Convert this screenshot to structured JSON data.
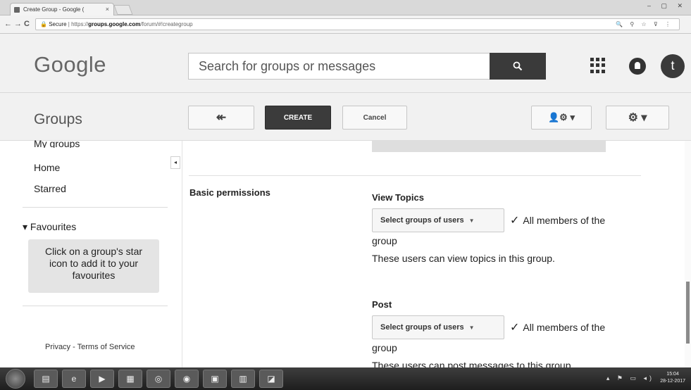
{
  "browser": {
    "tab_title": "Create Group - Google (",
    "tab_close": "×",
    "window_controls": "– ▢ ✕",
    "nav_back": "←",
    "nav_forward": "→",
    "nav_reload": "C",
    "url_secure": "Secure",
    "url_prefix": "https://",
    "url_host": "groups.google.com",
    "url_path": "/forum/#!creategroup",
    "omnibox_icons": "🔍 ⚲ ☆ ⊽ ⋮"
  },
  "header": {
    "logo": "Google",
    "search_placeholder": "Search for groups or messages",
    "avatar_letter": "t"
  },
  "toolbar": {
    "section_title": "Groups",
    "back_label": "↞",
    "create_label": "CREATE",
    "cancel_label": "Cancel",
    "members_label": "👤⚙ ▾",
    "settings_label": "⚙ ▾"
  },
  "sidebar": {
    "items": [
      {
        "label": "My groups"
      },
      {
        "label": "Home"
      },
      {
        "label": "Starred"
      }
    ],
    "favourites_heading": "▾ Favourites",
    "favourites_hint_line1": "Click on a group's star",
    "favourites_hint_line2": "icon to add it to your",
    "favourites_hint_line3": "favourites",
    "footer": "Privacy - Terms of Service",
    "collapse_glyph": "◂"
  },
  "main": {
    "section_label": "Basic permissions",
    "permissions": [
      {
        "title": "View Topics",
        "select_label": "Select groups of users",
        "value": "All members of the",
        "value_wrap": "group",
        "description": "These users can view topics in this group."
      },
      {
        "title": "Post",
        "select_label": "Select groups of users",
        "value": "All members of the",
        "value_wrap": "group",
        "description": "These users can post messages to this group."
      }
    ]
  },
  "taskbar": {
    "tray_icons": "▴ ⚑ ▭ ◂)",
    "clock_time": "15:04",
    "clock_date": "28-12-2017"
  }
}
